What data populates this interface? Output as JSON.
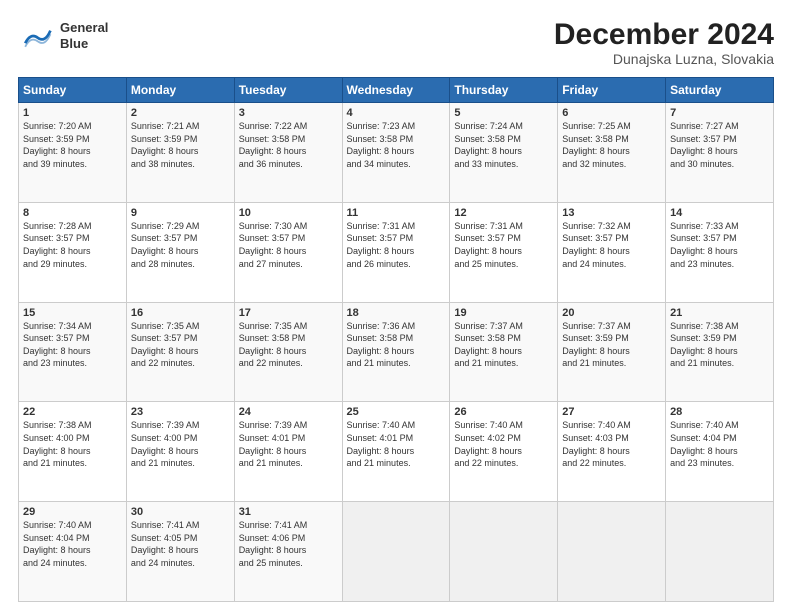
{
  "header": {
    "logo_line1": "General",
    "logo_line2": "Blue",
    "month": "December 2024",
    "location": "Dunajska Luzna, Slovakia"
  },
  "weekdays": [
    "Sunday",
    "Monday",
    "Tuesday",
    "Wednesday",
    "Thursday",
    "Friday",
    "Saturday"
  ],
  "weeks": [
    [
      {
        "day": "1",
        "info": "Sunrise: 7:20 AM\nSunset: 3:59 PM\nDaylight: 8 hours\nand 39 minutes."
      },
      {
        "day": "2",
        "info": "Sunrise: 7:21 AM\nSunset: 3:59 PM\nDaylight: 8 hours\nand 38 minutes."
      },
      {
        "day": "3",
        "info": "Sunrise: 7:22 AM\nSunset: 3:58 PM\nDaylight: 8 hours\nand 36 minutes."
      },
      {
        "day": "4",
        "info": "Sunrise: 7:23 AM\nSunset: 3:58 PM\nDaylight: 8 hours\nand 34 minutes."
      },
      {
        "day": "5",
        "info": "Sunrise: 7:24 AM\nSunset: 3:58 PM\nDaylight: 8 hours\nand 33 minutes."
      },
      {
        "day": "6",
        "info": "Sunrise: 7:25 AM\nSunset: 3:58 PM\nDaylight: 8 hours\nand 32 minutes."
      },
      {
        "day": "7",
        "info": "Sunrise: 7:27 AM\nSunset: 3:57 PM\nDaylight: 8 hours\nand 30 minutes."
      }
    ],
    [
      {
        "day": "8",
        "info": "Sunrise: 7:28 AM\nSunset: 3:57 PM\nDaylight: 8 hours\nand 29 minutes."
      },
      {
        "day": "9",
        "info": "Sunrise: 7:29 AM\nSunset: 3:57 PM\nDaylight: 8 hours\nand 28 minutes."
      },
      {
        "day": "10",
        "info": "Sunrise: 7:30 AM\nSunset: 3:57 PM\nDaylight: 8 hours\nand 27 minutes."
      },
      {
        "day": "11",
        "info": "Sunrise: 7:31 AM\nSunset: 3:57 PM\nDaylight: 8 hours\nand 26 minutes."
      },
      {
        "day": "12",
        "info": "Sunrise: 7:31 AM\nSunset: 3:57 PM\nDaylight: 8 hours\nand 25 minutes."
      },
      {
        "day": "13",
        "info": "Sunrise: 7:32 AM\nSunset: 3:57 PM\nDaylight: 8 hours\nand 24 minutes."
      },
      {
        "day": "14",
        "info": "Sunrise: 7:33 AM\nSunset: 3:57 PM\nDaylight: 8 hours\nand 23 minutes."
      }
    ],
    [
      {
        "day": "15",
        "info": "Sunrise: 7:34 AM\nSunset: 3:57 PM\nDaylight: 8 hours\nand 23 minutes."
      },
      {
        "day": "16",
        "info": "Sunrise: 7:35 AM\nSunset: 3:57 PM\nDaylight: 8 hours\nand 22 minutes."
      },
      {
        "day": "17",
        "info": "Sunrise: 7:35 AM\nSunset: 3:58 PM\nDaylight: 8 hours\nand 22 minutes."
      },
      {
        "day": "18",
        "info": "Sunrise: 7:36 AM\nSunset: 3:58 PM\nDaylight: 8 hours\nand 21 minutes."
      },
      {
        "day": "19",
        "info": "Sunrise: 7:37 AM\nSunset: 3:58 PM\nDaylight: 8 hours\nand 21 minutes."
      },
      {
        "day": "20",
        "info": "Sunrise: 7:37 AM\nSunset: 3:59 PM\nDaylight: 8 hours\nand 21 minutes."
      },
      {
        "day": "21",
        "info": "Sunrise: 7:38 AM\nSunset: 3:59 PM\nDaylight: 8 hours\nand 21 minutes."
      }
    ],
    [
      {
        "day": "22",
        "info": "Sunrise: 7:38 AM\nSunset: 4:00 PM\nDaylight: 8 hours\nand 21 minutes."
      },
      {
        "day": "23",
        "info": "Sunrise: 7:39 AM\nSunset: 4:00 PM\nDaylight: 8 hours\nand 21 minutes."
      },
      {
        "day": "24",
        "info": "Sunrise: 7:39 AM\nSunset: 4:01 PM\nDaylight: 8 hours\nand 21 minutes."
      },
      {
        "day": "25",
        "info": "Sunrise: 7:40 AM\nSunset: 4:01 PM\nDaylight: 8 hours\nand 21 minutes."
      },
      {
        "day": "26",
        "info": "Sunrise: 7:40 AM\nSunset: 4:02 PM\nDaylight: 8 hours\nand 22 minutes."
      },
      {
        "day": "27",
        "info": "Sunrise: 7:40 AM\nSunset: 4:03 PM\nDaylight: 8 hours\nand 22 minutes."
      },
      {
        "day": "28",
        "info": "Sunrise: 7:40 AM\nSunset: 4:04 PM\nDaylight: 8 hours\nand 23 minutes."
      }
    ],
    [
      {
        "day": "29",
        "info": "Sunrise: 7:40 AM\nSunset: 4:04 PM\nDaylight: 8 hours\nand 24 minutes."
      },
      {
        "day": "30",
        "info": "Sunrise: 7:41 AM\nSunset: 4:05 PM\nDaylight: 8 hours\nand 24 minutes."
      },
      {
        "day": "31",
        "info": "Sunrise: 7:41 AM\nSunset: 4:06 PM\nDaylight: 8 hours\nand 25 minutes."
      },
      {
        "day": "",
        "info": ""
      },
      {
        "day": "",
        "info": ""
      },
      {
        "day": "",
        "info": ""
      },
      {
        "day": "",
        "info": ""
      }
    ]
  ]
}
